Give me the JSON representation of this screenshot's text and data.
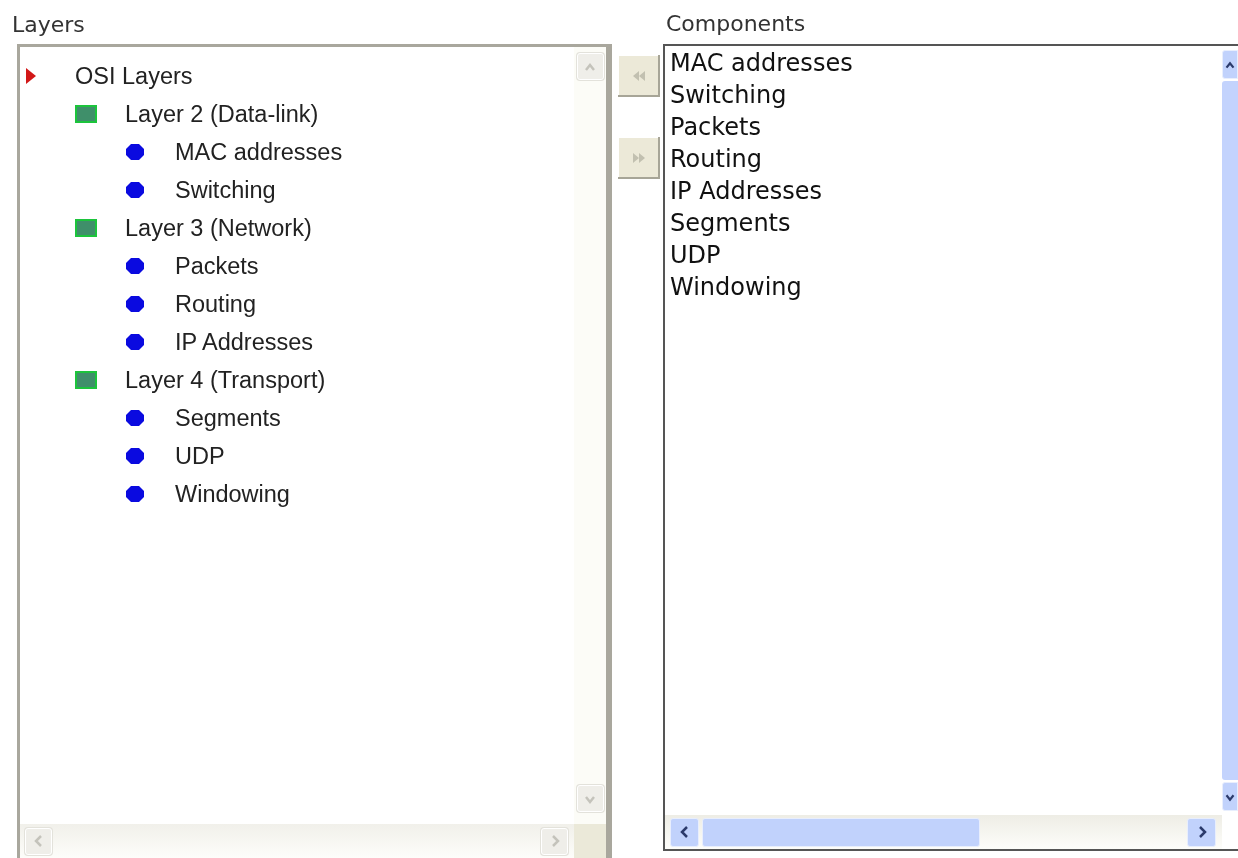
{
  "layers_label": "Layers",
  "tree": {
    "label": "OSI Layers",
    "kind": "root",
    "children": [
      {
        "label": "Layer 2 (Data-link)",
        "kind": "group",
        "children": [
          {
            "label": "MAC addresses",
            "kind": "leaf"
          },
          {
            "label": "Switching",
            "kind": "leaf"
          }
        ]
      },
      {
        "label": "Layer 3 (Network)",
        "kind": "group",
        "children": [
          {
            "label": "Packets",
            "kind": "leaf"
          },
          {
            "label": "Routing",
            "kind": "leaf"
          },
          {
            "label": "IP Addresses",
            "kind": "leaf"
          }
        ]
      },
      {
        "label": "Layer 4 (Transport)",
        "kind": "group",
        "children": [
          {
            "label": "Segments",
            "kind": "leaf"
          },
          {
            "label": "UDP",
            "kind": "leaf"
          },
          {
            "label": "Windowing",
            "kind": "leaf"
          }
        ]
      }
    ]
  },
  "move_buttons": [
    {
      "kind": "left",
      "disabled": true
    },
    {
      "kind": "right",
      "disabled": true
    }
  ],
  "components_label": "Components",
  "components": [
    "MAC addresses",
    "Switching",
    "Packets",
    "Routing",
    "IP Addresses",
    "Segments",
    "UDP",
    "Windowing"
  ]
}
